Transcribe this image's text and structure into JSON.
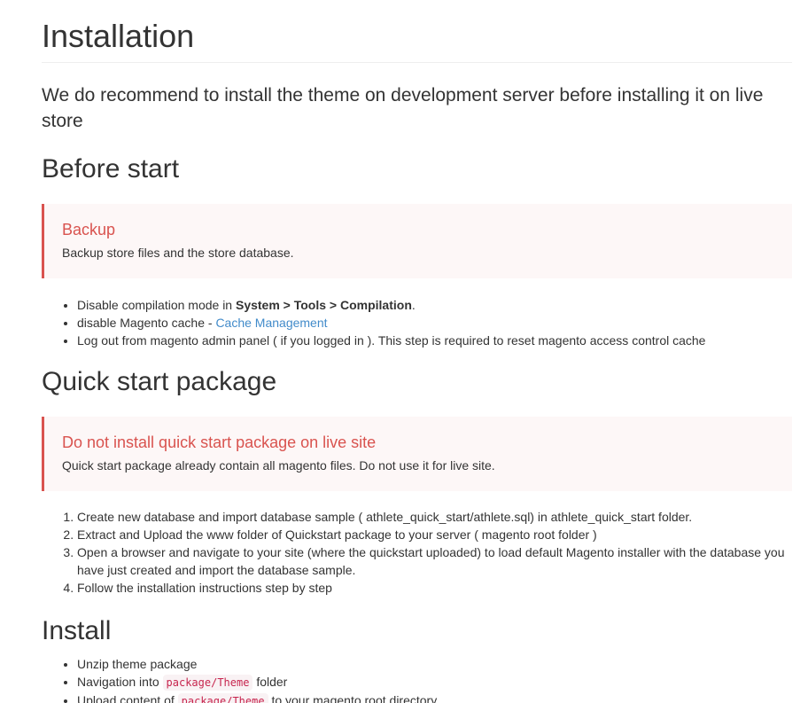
{
  "title": "Installation",
  "lead": "We do recommend to install the theme on development server before installing it on live store",
  "before_start": {
    "heading": "Before start",
    "callout": {
      "title": "Backup",
      "text": "Backup store files and the store database."
    },
    "items": [
      {
        "prefix": "Disable compilation mode in ",
        "bold": "System > Tools > Compilation",
        "suffix": "."
      },
      {
        "prefix": "disable Magento cache - ",
        "link": "Cache Management"
      },
      {
        "text": "Log out from magento admin panel ( if you logged in ). This step is required to reset magento access control cache"
      }
    ]
  },
  "quick_start": {
    "heading": "Quick start package",
    "callout": {
      "title": "Do not install quick start package on live site",
      "text": "Quick start package already contain all magento files. Do not use it for live site."
    },
    "steps": [
      "Create new database and import database sample ( athlete_quick_start/athlete.sql) in athlete_quick_start folder.",
      "Extract and Upload the www folder of Quickstart package to your server ( magento root folder )",
      "Open a browser and navigate to your site (where the quickstart uploaded) to load default Magento installer with the database you have just created and import the database sample.",
      "Follow the installation instructions step by step"
    ]
  },
  "install": {
    "heading": "Install",
    "items": [
      {
        "text": "Unzip theme package"
      },
      {
        "prefix": "Navigation into ",
        "code": "package/Theme",
        "suffix": " folder"
      },
      {
        "prefix": "Upload content of ",
        "code": "package/Theme",
        "suffix": " to your magento root directory."
      }
    ]
  }
}
